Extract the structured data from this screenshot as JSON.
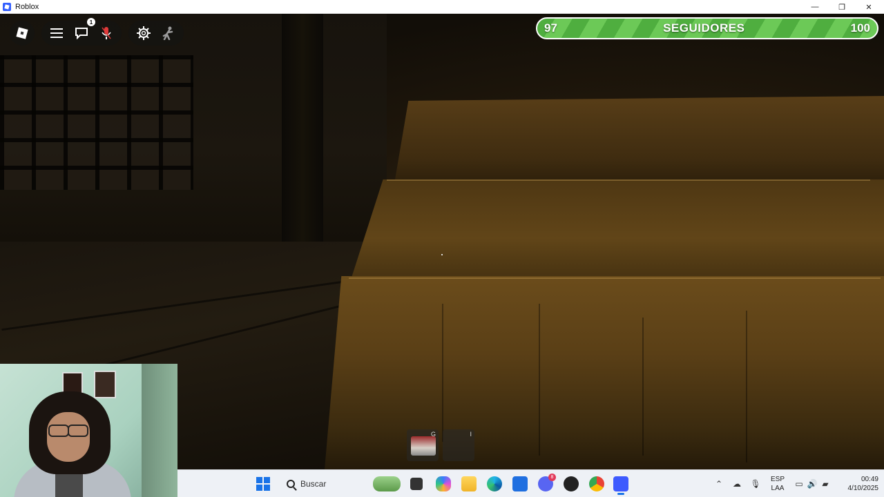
{
  "window": {
    "title": "Roblox",
    "minimize": "—",
    "maximize": "❐",
    "close": "✕"
  },
  "roblox_controls": {
    "chat_badge": "1",
    "icons": [
      "roblox-logo-icon",
      "menu-icon",
      "chat-icon",
      "microphone-icon",
      "settings-icon",
      "emote-icon"
    ]
  },
  "followers_bar": {
    "current": "97",
    "label": "SEGUIDORES",
    "goal": "100",
    "progress_fraction": 0.97,
    "colors": {
      "fill_a": "#4fae3f",
      "fill_b": "#6cc957",
      "border": "#ffffff"
    }
  },
  "hotbar": {
    "slots": [
      {
        "key": "G",
        "has_item": true
      },
      {
        "key": "I",
        "has_item": false
      }
    ]
  },
  "taskbar": {
    "search_placeholder": "Buscar",
    "apps": [
      "weather-widget-icon",
      "task-view-icon",
      "copilot-icon",
      "file-explorer-icon",
      "edge-icon",
      "microsoft-store-icon",
      "discord-icon",
      "obs-icon",
      "chrome-icon",
      "roblox-icon"
    ],
    "discord_badge": "8",
    "tray": {
      "language_line1": "ESP",
      "language_line2": "LAA",
      "time": "00:49",
      "date": "4/10/2025"
    }
  }
}
